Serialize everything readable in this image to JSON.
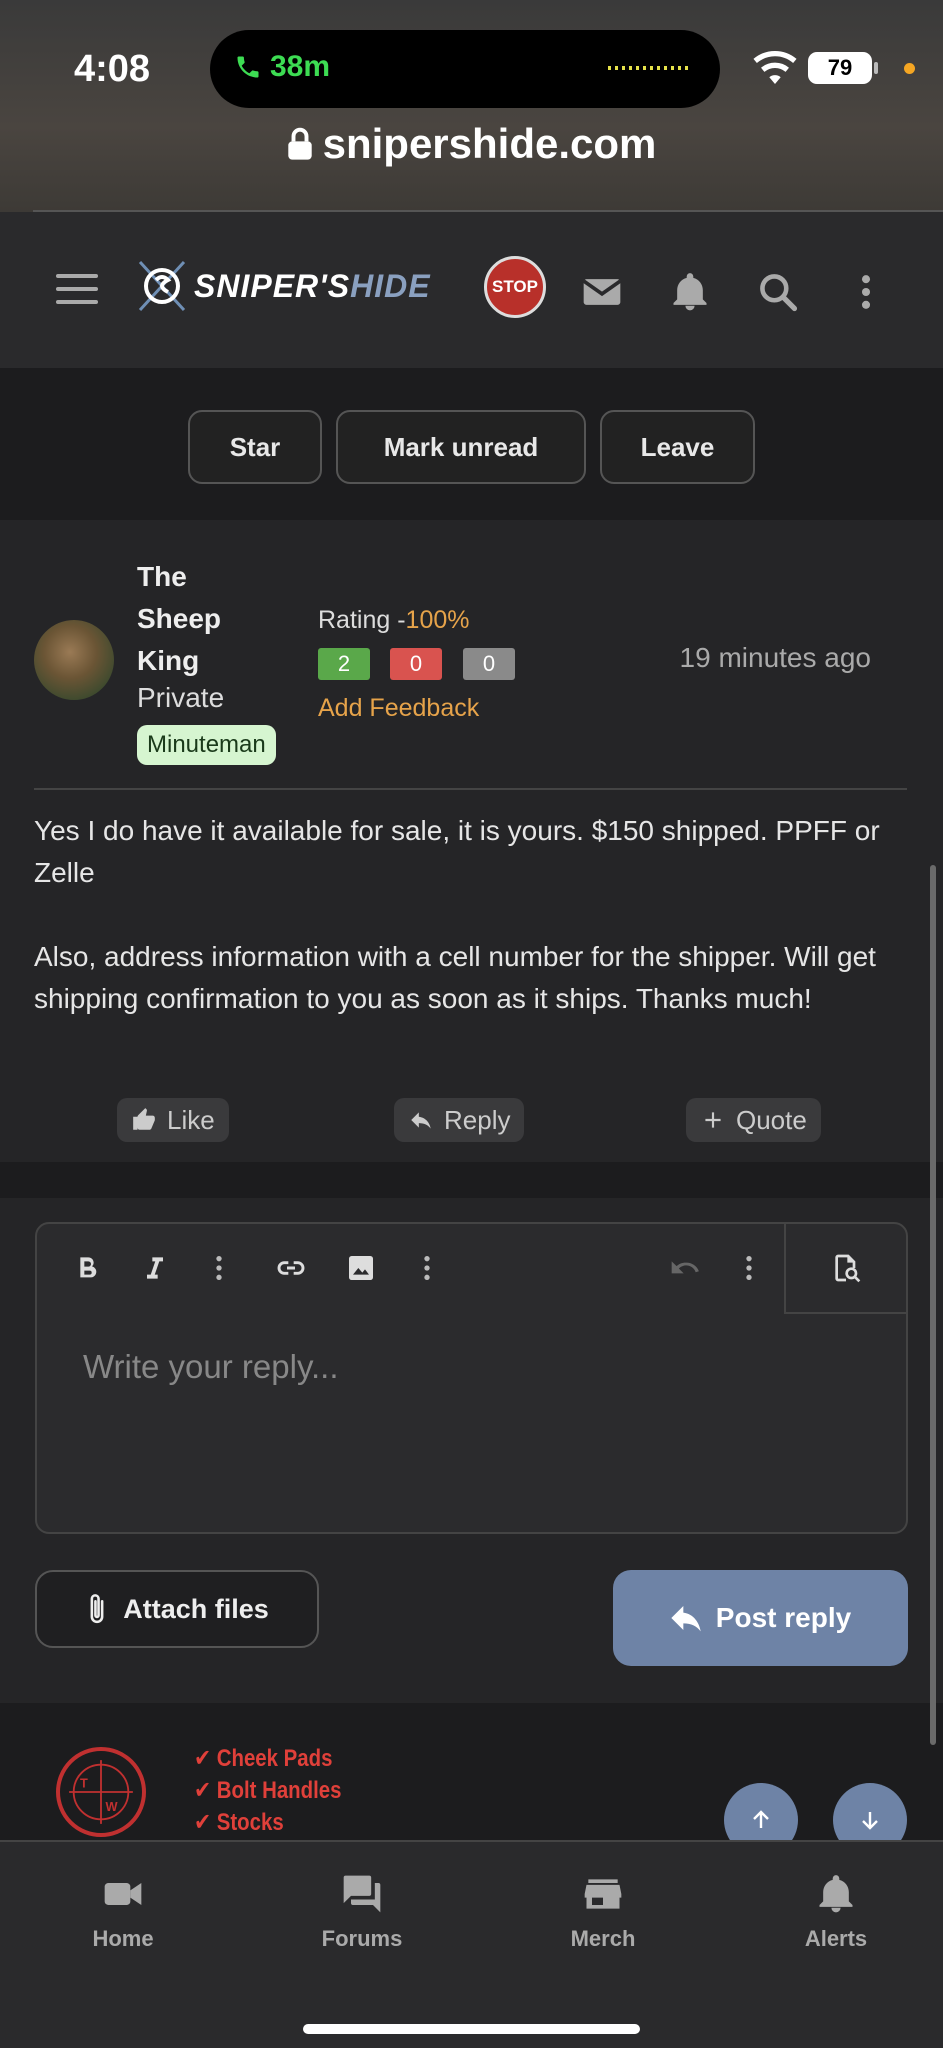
{
  "status_bar": {
    "time": "4:08",
    "call_duration": "38m",
    "battery": "79",
    "url": "snipershide.com"
  },
  "site_header": {
    "logo_text_a": "SNIPER'S",
    "logo_text_b": "HIDE",
    "stop_badge_text": "STOP"
  },
  "thread_actions": {
    "star_label": "Star",
    "mark_unread_label": "Mark unread",
    "leave_label": "Leave"
  },
  "post": {
    "username": "The Sheep King",
    "user_title": "Private",
    "user_badge": "Minuteman",
    "rating_label": "Rating -",
    "rating_pct": "100%",
    "feedback_positive": "2",
    "feedback_negative": "0",
    "feedback_neutral": "0",
    "add_feedback_label": "Add Feedback",
    "time_ago": "19 minutes ago",
    "message_p1": "Yes I do have it available for sale, it is yours. $150 shipped. PPFF or Zelle",
    "message_p2": "Also, address information with a cell number for the shipper. Will get shipping confirmation to you as soon as it ships. Thanks much!",
    "like_label": "Like",
    "reply_label": "Reply",
    "quote_label": "Quote"
  },
  "editor": {
    "placeholder": "Write your reply...",
    "attach_label": "Attach files",
    "post_reply_label": "Post reply"
  },
  "ad": {
    "items": [
      "Cheek Pads",
      "Bolt Handles",
      "Stocks"
    ]
  },
  "tab_bar": {
    "tabs": [
      {
        "label": "Home",
        "icon": "video-camera-icon"
      },
      {
        "label": "Forums",
        "icon": "chat-bubbles-icon"
      },
      {
        "label": "Merch",
        "icon": "store-icon"
      },
      {
        "label": "Alerts",
        "icon": "bell-icon"
      }
    ]
  },
  "colors": {
    "accent_blue": "#6e83a6",
    "rating_orange": "#e6a34a",
    "feedback_green": "#5aa84a",
    "feedback_red": "#d9534f",
    "feedback_gray": "#8a8a8a"
  }
}
